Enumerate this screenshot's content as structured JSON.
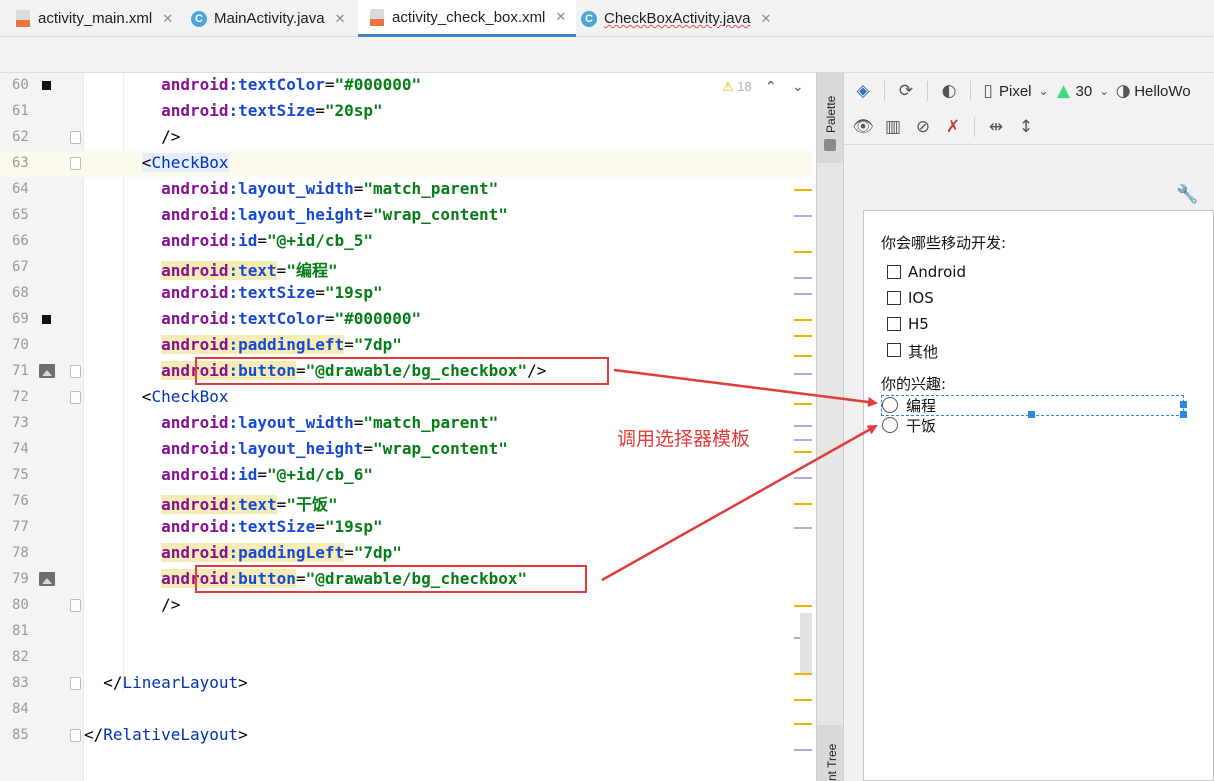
{
  "tabs": [
    {
      "label": "activity_main.xml",
      "icon": "xml-file-icon",
      "active": false
    },
    {
      "label": "MainActivity.java",
      "icon": "java-class-icon",
      "active": false
    },
    {
      "label": "activity_check_box.xml",
      "icon": "xml-file-icon",
      "active": true
    },
    {
      "label": "CheckBoxActivity.java",
      "icon": "java-class-icon",
      "active": false
    }
  ],
  "editor": {
    "warning_count": "18",
    "lines": [
      {
        "num": "60",
        "text": "android:textColor=\"#000000\""
      },
      {
        "num": "61",
        "text": "android:textSize=\"20sp\""
      },
      {
        "num": "62",
        "text": "/>"
      },
      {
        "num": "63",
        "text": "<CheckBox"
      },
      {
        "num": "64",
        "text": "android:layout_width=\"match_parent\""
      },
      {
        "num": "65",
        "text": "android:layout_height=\"wrap_content\""
      },
      {
        "num": "66",
        "text": "android:id=\"@+id/cb_5\""
      },
      {
        "num": "67",
        "text": "android:text=\"编程\""
      },
      {
        "num": "68",
        "text": "android:textSize=\"19sp\""
      },
      {
        "num": "69",
        "text": "android:textColor=\"#000000\""
      },
      {
        "num": "70",
        "text": "android:paddingLeft=\"7dp\""
      },
      {
        "num": "71",
        "text": "android:button=\"@drawable/bg_checkbox\"/>"
      },
      {
        "num": "72",
        "text": "<CheckBox"
      },
      {
        "num": "73",
        "text": "android:layout_width=\"match_parent\""
      },
      {
        "num": "74",
        "text": "android:layout_height=\"wrap_content\""
      },
      {
        "num": "75",
        "text": "android:id=\"@+id/cb_6\""
      },
      {
        "num": "76",
        "text": "android:text=\"干饭\""
      },
      {
        "num": "77",
        "text": "android:textSize=\"19sp\""
      },
      {
        "num": "78",
        "text": "android:paddingLeft=\"7dp\""
      },
      {
        "num": "79",
        "text": "android:button=\"@drawable/bg_checkbox\""
      },
      {
        "num": "80",
        "text": "/>"
      },
      {
        "num": "81",
        "text": ""
      },
      {
        "num": "82",
        "text": ""
      },
      {
        "num": "83",
        "text": "</LinearLayout>"
      },
      {
        "num": "84",
        "text": ""
      },
      {
        "num": "85",
        "text": "</RelativeLayout>"
      }
    ]
  },
  "annotation": {
    "text": "调用选择器模板",
    "color": "#e23b3b"
  },
  "side_panels": {
    "palette": "Palette",
    "component_tree": "nt Tree"
  },
  "design_toolbar": {
    "device": "Pixel",
    "api_level": "30",
    "theme": "HelloWo"
  },
  "preview": {
    "question1": "你会哪些移动开发:",
    "options1": [
      "Android",
      "IOS",
      "H5",
      "其他"
    ],
    "question2": "你的兴趣:",
    "options2": [
      "编程",
      "干饭"
    ]
  },
  "colors": {
    "accent": "#4083c9",
    "keyword_attr": "#174ad4",
    "string_value": "#067d17",
    "namespace": "#871094",
    "tag": "#0033b3",
    "selection": "#2f86e6"
  }
}
